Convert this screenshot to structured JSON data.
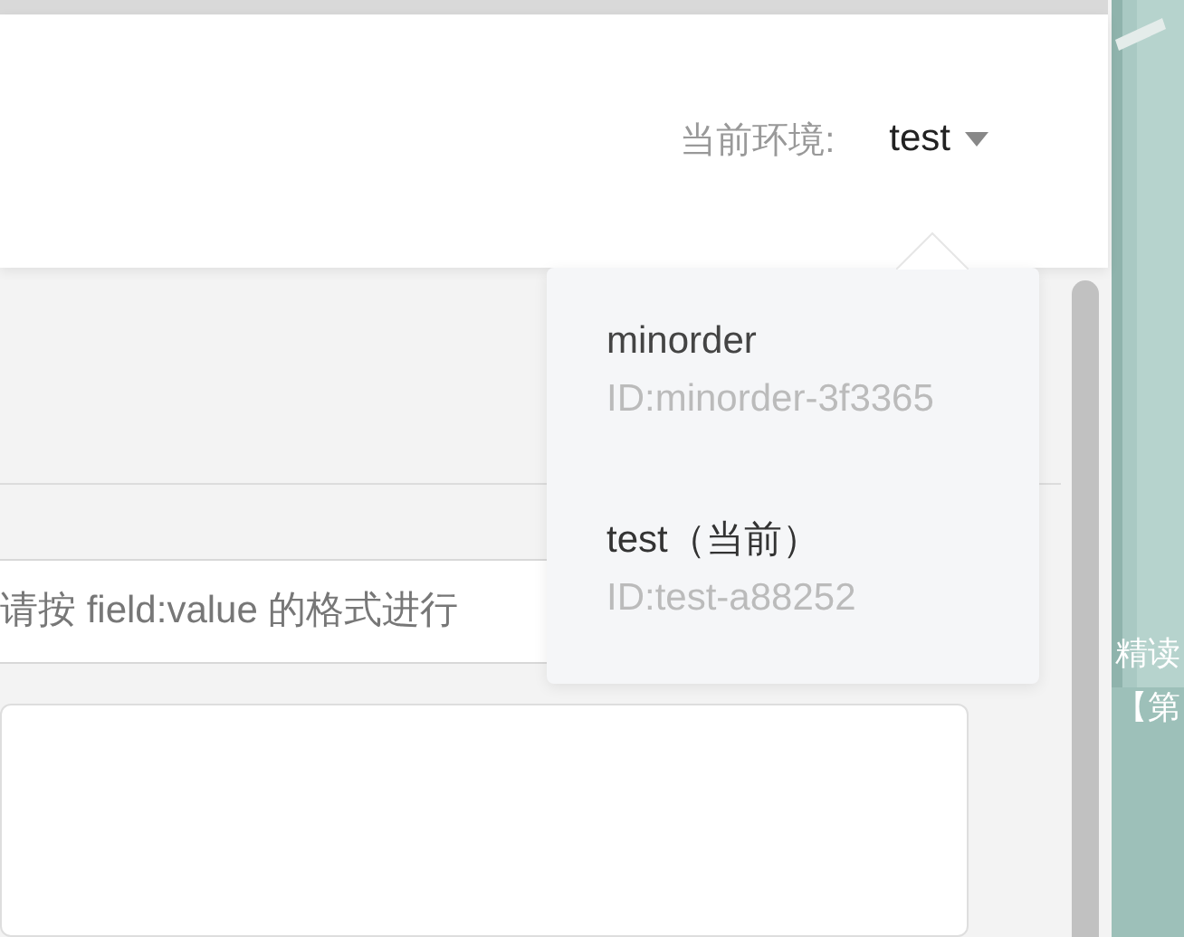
{
  "header": {
    "env_label": "当前环境:",
    "env_value": "test"
  },
  "search": {
    "placeholder": "请按 field:value 的格式进行"
  },
  "env_menu": {
    "items": [
      {
        "name": "minorder",
        "id": "ID:minorder-3f3365",
        "selected": false
      },
      {
        "name": "test（当前）",
        "id": "ID:test-a88252",
        "selected": true
      }
    ]
  },
  "background_window": {
    "texts": [
      "精读",
      "【第"
    ]
  }
}
